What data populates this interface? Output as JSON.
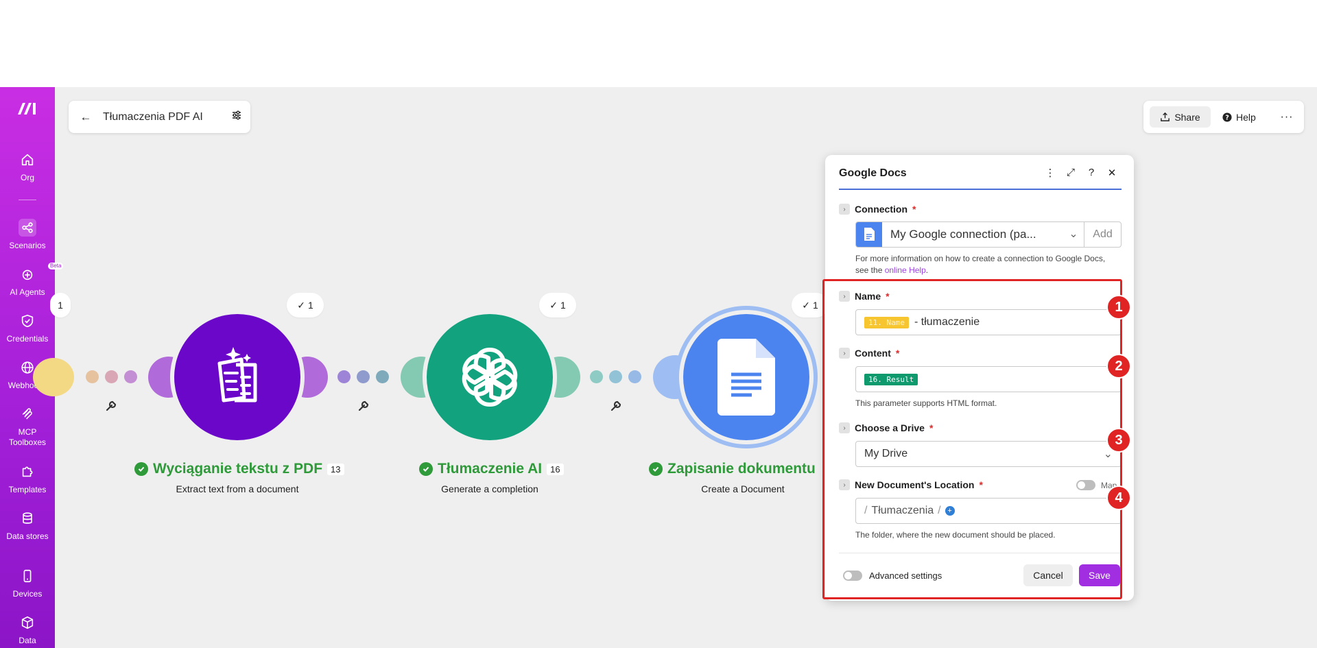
{
  "sidebar": {
    "items": [
      {
        "label": "Org",
        "icon": "home-icon"
      },
      {
        "label": "Scenarios",
        "icon": "share-nodes-icon"
      },
      {
        "label": "AI Agents",
        "icon": "ai-agent-icon",
        "badge": "Beta"
      },
      {
        "label": "Credentials",
        "icon": "shield-check-icon"
      },
      {
        "label": "Webhooks",
        "icon": "globe-icon"
      },
      {
        "label": "MCP Toolboxes",
        "icon": "mcp-icon"
      },
      {
        "label": "Templates",
        "icon": "puzzle-icon"
      },
      {
        "label": "Data stores",
        "icon": "database-icon"
      },
      {
        "label": "Devices",
        "icon": "phone-icon"
      },
      {
        "label": "Data structures",
        "icon": "cube-icon"
      }
    ]
  },
  "header": {
    "scenario_title": "Tłumaczenia PDF AI",
    "share_label": "Share",
    "help_label": "Help"
  },
  "flow": {
    "left_badge": "1",
    "nodes": [
      {
        "title": "Wyciąganie tekstu z PDF",
        "count": "13",
        "subtitle": "Extract text from a document",
        "ops": "1",
        "color": "#6a07c8"
      },
      {
        "title": "Tłumaczenie AI",
        "count": "16",
        "subtitle": "Generate a completion",
        "ops": "1",
        "color": "#12a37e"
      },
      {
        "title": "Zapisanie dokumentu",
        "count": "",
        "subtitle": "Create a Document",
        "ops": "1",
        "color": "#4c84ef"
      }
    ]
  },
  "panel": {
    "title": "Google Docs",
    "connection": {
      "label": "Connection",
      "value": "My Google connection (pa...",
      "add_label": "Add",
      "hint_prefix": "For more information on how to create a connection to Google Docs, see the ",
      "hint_link": "online Help",
      "hint_suffix": "."
    },
    "name": {
      "label": "Name",
      "pill": "11. Name",
      "text": "- tłumaczenie"
    },
    "content": {
      "label": "Content",
      "pill": "16. Result",
      "hint": "This parameter supports HTML format."
    },
    "drive": {
      "label": "Choose a Drive",
      "value": "My Drive"
    },
    "location": {
      "label": "New Document's Location",
      "map_label": "Map",
      "folder": "Tłumaczenia",
      "hint": "The folder, where the new document should be placed."
    },
    "advanced_label": "Advanced settings",
    "cancel_label": "Cancel",
    "save_label": "Save"
  },
  "annotations": [
    "1",
    "2",
    "3",
    "4"
  ]
}
